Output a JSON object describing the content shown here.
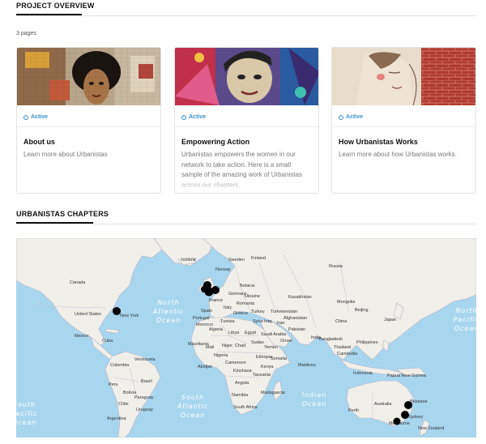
{
  "project_overview": {
    "title": "PROJECT OVERVIEW",
    "page_count": "3 pages"
  },
  "cards": [
    {
      "status": "Active",
      "title": "About us",
      "description": "Learn more about Urbanistas"
    },
    {
      "status": "Active",
      "title": "Empowering Action",
      "description": "Urbanistas empowers the women in our network to take action. Here is a small sample of the amazing work of Urbanistas across our chapters."
    },
    {
      "status": "Active",
      "title": "How Urbanistas Works",
      "description": "Learn more about how Urbanistas works."
    }
  ],
  "chapters": {
    "title": "URBANISTAS CHAPTERS"
  },
  "map": {
    "oceans": {
      "north_atlantic": [
        "North",
        "Atlantic",
        "Ocean"
      ],
      "south_atlantic": [
        "South",
        "Atlantic",
        "Ocean"
      ],
      "indian": [
        "Indian",
        "Ocean"
      ],
      "north_pacific": [
        "North",
        "Pacific",
        "Ocean"
      ],
      "south_pacific": [
        "South",
        "Pacific",
        "Ocean"
      ]
    },
    "places": {
      "iceland": "Iceland",
      "norway": "Norway",
      "sweden": "Sweden",
      "finland": "Finland",
      "russia": "Russia",
      "canada": "Canada",
      "united_states": "United States",
      "new_york": "New York",
      "mexico": "Mexico",
      "cuba": "Cuba",
      "venezuela": "Venezuela",
      "colombia": "Colombia",
      "peru": "Peru",
      "brazil": "Brazil",
      "bolivia": "Bolivia",
      "chile": "Chile",
      "paraguay": "Paraguay",
      "uruguay": "Uruguay",
      "argentina": "Argentina",
      "france": "France",
      "spain": "Spain",
      "portugal": "Portugal",
      "italy": "Italy",
      "germany": "Germany",
      "belarus": "Belarus",
      "ukraine": "Ukraine",
      "romania": "Romania",
      "greece": "Greece",
      "turkey": "Turkey",
      "morocco": "Morocco",
      "algeria": "Algeria",
      "tunisia": "Tunisia",
      "libya": "Libya",
      "egypt": "Egypt",
      "mauritania": "Mauritania",
      "mali": "Mali",
      "niger": "Niger",
      "chad": "Chad",
      "sudan": "Sudan",
      "ethiopia": "Ethiopia",
      "nigeria": "Nigeria",
      "cameroon": "Cameroon",
      "abidjan": "Abidjan",
      "kinshasa": "Kinshasa",
      "angola": "Angola",
      "namibia": "Namibia",
      "tanzania": "Tanzania",
      "kenya": "Kenya",
      "madagascar": "Madagascar",
      "south_africa": "South Africa",
      "somalia": "Somalia",
      "iraq": "Iraq",
      "iran": "Iran",
      "syria": "Syria",
      "saudi_arabia": "Saudi Arabia",
      "yemen": "Yemen",
      "oman": "Oman",
      "kazakhstan": "Kazakhstan",
      "turkmenistan": "Turkmenistan",
      "afghanistan": "Afghanistan",
      "pakistan": "Pakistan",
      "india": "India",
      "china": "China",
      "mongolia": "Mongolia",
      "beijing": "Beijing",
      "japan": "Japan",
      "bangladesh": "Bangladesh",
      "thailand": "Thailand",
      "cambodia": "Cambodia",
      "philippines": "Philippines",
      "indonesia": "Indonesia",
      "maldives": "Maldives",
      "papua_new_guinea": "Papua New Guinea",
      "australia": "Australia",
      "perth": "Perth",
      "brisbane": "Brisbane",
      "sydney": "Sydney",
      "melbourne": "Melbourne",
      "new_zealand": "New Zealand"
    },
    "markers": [
      "New York",
      "London",
      "Dublin",
      "Edinburgh",
      "Brisbane",
      "Sydney",
      "Melbourne"
    ],
    "colors": {
      "water": "#a8d6ef",
      "land": "#f1efe9",
      "border": "#b9b3c4",
      "marker": "#000000"
    }
  }
}
